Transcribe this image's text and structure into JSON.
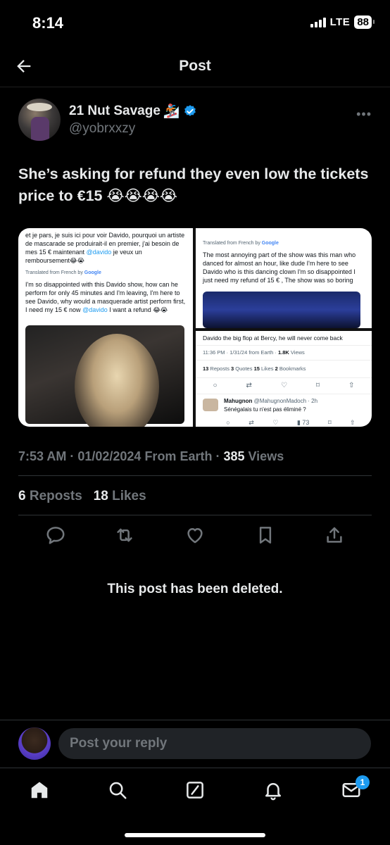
{
  "status_bar": {
    "time": "8:14",
    "network": "LTE",
    "battery": "88"
  },
  "nav": {
    "title": "Post"
  },
  "author": {
    "name": "21 Nut Savage",
    "emoji": "🏂",
    "handle": "@yobrxxzy",
    "verified": true
  },
  "tweet": {
    "text": "She’s asking for refund they even low the tickets price to €15 😭😭😭😭"
  },
  "media": {
    "left": {
      "french_text_1": "et je pars, je suis ici pour voir Davido, pourquoi un artiste de mascarade se produirait-il en premier, j'ai besoin de mes 15 € maintenant ",
      "french_mention": "@davido",
      "french_text_2": " je veux un remboursement😂😭",
      "translated_label": "Translated from French by ",
      "google": "Google",
      "english_text_1": "I'm so disappointed with this Davido show, how can he perform for only 45 minutes and I'm leaving, I'm here to see Davido, why would a masquerade artist perform first, I need my 15 € now ",
      "english_mention": "@davido",
      "english_text_2": " I want a refund 😂😭"
    },
    "right_top": {
      "translated_label": "Translated from French by ",
      "google": "Google",
      "english_text": "The most annoying part of the show was this man who danced for almost an hour, like dude I'm here to see Davido who is this dancing clown I'm so disappointed I just need my refund of 15 € , The show was so boring"
    },
    "right_bottom": {
      "text": "Davido the big flop at Bercy, he will never come back",
      "meta": "11:36 PM · 1/31/24 from Earth · ",
      "views_num": "1.8K",
      "views_label": " Views",
      "reposts_num": "13",
      "reposts_label": " Reposts  ",
      "quotes_num": "3",
      "quotes_label": " Quotes  ",
      "likes_num": "15",
      "likes_label": " Likes  ",
      "bookmarks_num": "2",
      "bookmarks_label": " Bookmarks",
      "reply_name": "Mahugnon",
      "reply_handle": " @MahugnonMadoch · 2h",
      "reply_text": "Sénégalais tu n'est pas éliminé ?",
      "reply_views": "73"
    }
  },
  "meta": {
    "time_date": "7:53 AM · 01/02/2024 From Earth · ",
    "views_num": "385",
    "views_label": " Views"
  },
  "stats": {
    "reposts_num": "6",
    "reposts_label": " Reposts",
    "likes_num": "18",
    "likes_label": " Likes"
  },
  "deleted_notice": "This post has been deleted.",
  "reply": {
    "placeholder": "Post your reply"
  },
  "tabbar": {
    "notification_badge": "1"
  },
  "colors": {
    "accent": "#1d9bf0",
    "background": "#000000",
    "muted": "#71767b"
  },
  "icons": [
    "back-arrow-icon",
    "verified-badge-icon",
    "more-icon",
    "reply-icon",
    "repost-icon",
    "like-icon",
    "bookmark-icon",
    "share-icon",
    "home-icon",
    "search-icon",
    "grok-icon",
    "notifications-icon",
    "messages-icon"
  ]
}
